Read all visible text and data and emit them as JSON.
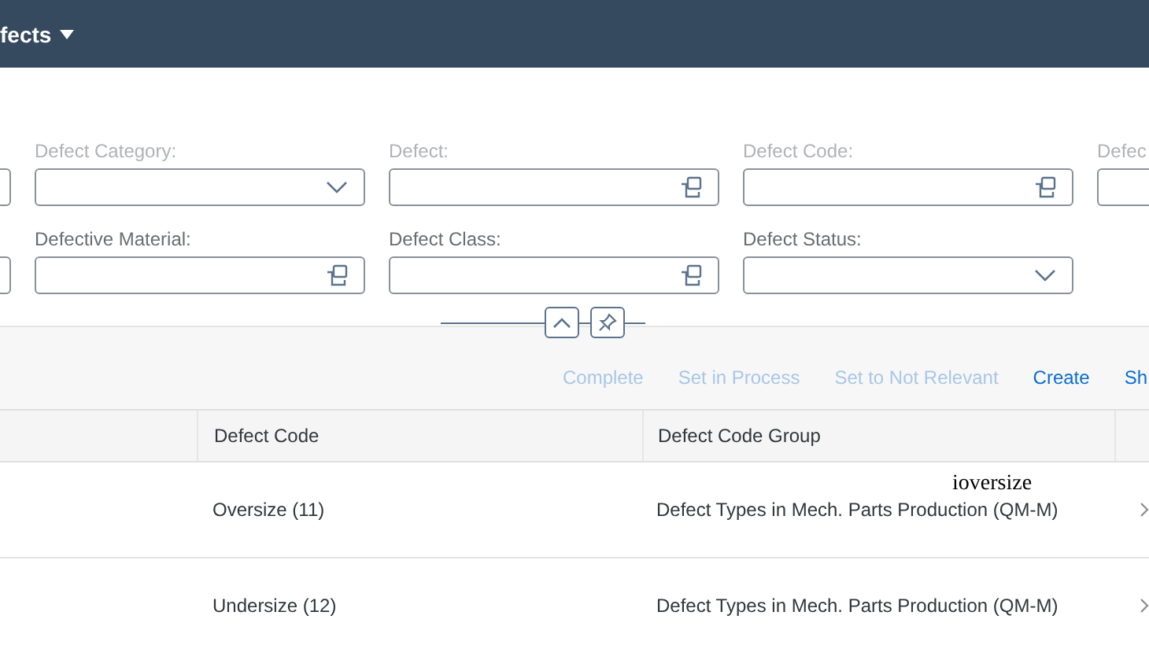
{
  "header": {
    "title": "fects"
  },
  "filters": {
    "rows": [
      [
        {
          "kind": "input"
        },
        {
          "label": "Defect Category:",
          "kind": "dropdown"
        },
        {
          "label": "Defect:",
          "kind": "value_help"
        },
        {
          "label": "Defect Code:",
          "kind": "value_help"
        },
        {
          "label": "Defec",
          "kind": "input"
        }
      ],
      [
        {
          "kind": "input"
        },
        {
          "label": "Defective Material:",
          "kind": "value_help"
        },
        {
          "label": "Defect Class:",
          "kind": "value_help"
        },
        {
          "label": "Defect Status:",
          "kind": "dropdown"
        }
      ]
    ]
  },
  "actions": [
    {
      "label": "Complete",
      "disabled": true
    },
    {
      "label": "Set in Process",
      "disabled": true
    },
    {
      "label": "Set to Not Relevant",
      "disabled": true
    },
    {
      "label": "Create",
      "disabled": false
    },
    {
      "label": "Sh",
      "disabled": false
    }
  ],
  "table": {
    "columns": [
      "Defect Code",
      "Defect Code Group"
    ],
    "rows": [
      {
        "defect_code": "Oversize (11)",
        "defect_code_group": "Defect Types in Mech. Parts Production (QM-M)",
        "annotation": "ioversize"
      },
      {
        "defect_code": "Undersize (12)",
        "defect_code_group": "Defect Types in Mech. Parts Production (QM-M)"
      }
    ]
  }
}
